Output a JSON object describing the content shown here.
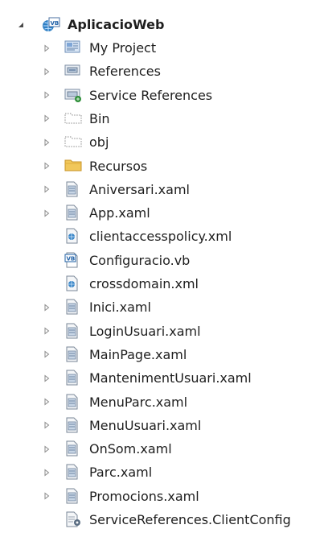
{
  "solution_explorer": {
    "root": {
      "label": "AplicacioWeb",
      "icon": "vb-web-project-icon",
      "expanded": true
    },
    "items": [
      {
        "label": "My Project",
        "icon": "my-project-icon",
        "expandable": true
      },
      {
        "label": "References",
        "icon": "references-icon",
        "expandable": true
      },
      {
        "label": "Service References",
        "icon": "service-references-icon",
        "expandable": true
      },
      {
        "label": "Bin",
        "icon": "folder-dotted-icon",
        "expandable": true
      },
      {
        "label": "obj",
        "icon": "folder-dotted-icon",
        "expandable": true
      },
      {
        "label": "Recursos",
        "icon": "folder-icon",
        "expandable": true
      },
      {
        "label": "Aniversari.xaml",
        "icon": "xaml-file-icon",
        "expandable": true
      },
      {
        "label": "App.xaml",
        "icon": "xaml-file-icon",
        "expandable": true
      },
      {
        "label": "clientaccesspolicy.xml",
        "icon": "xml-file-icon",
        "expandable": false
      },
      {
        "label": "Configuracio.vb",
        "icon": "vb-file-icon",
        "expandable": false
      },
      {
        "label": "crossdomain.xml",
        "icon": "xml-file-icon",
        "expandable": false
      },
      {
        "label": "Inici.xaml",
        "icon": "xaml-file-icon",
        "expandable": true
      },
      {
        "label": "LoginUsuari.xaml",
        "icon": "xaml-file-icon",
        "expandable": true
      },
      {
        "label": "MainPage.xaml",
        "icon": "xaml-file-icon",
        "expandable": true
      },
      {
        "label": "MantenimentUsuari.xaml",
        "icon": "xaml-file-icon",
        "expandable": true
      },
      {
        "label": "MenuParc.xaml",
        "icon": "xaml-file-icon",
        "expandable": true
      },
      {
        "label": "MenuUsuari.xaml",
        "icon": "xaml-file-icon",
        "expandable": true
      },
      {
        "label": "OnSom.xaml",
        "icon": "xaml-file-icon",
        "expandable": true
      },
      {
        "label": "Parc.xaml",
        "icon": "xaml-file-icon",
        "expandable": true
      },
      {
        "label": "Promocions.xaml",
        "icon": "xaml-file-icon",
        "expandable": true
      },
      {
        "label": "ServiceReferences.ClientConfig",
        "icon": "config-file-icon",
        "expandable": false
      }
    ]
  }
}
